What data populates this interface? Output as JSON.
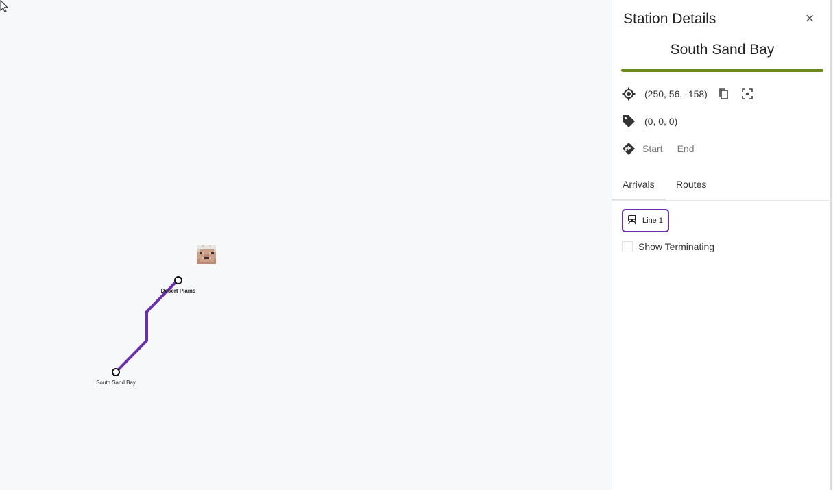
{
  "map": {
    "line_color": "#6a2fb0",
    "stations": [
      {
        "name": "Desert Plains",
        "bold": true
      },
      {
        "name": "South Sand Bay",
        "bold": false
      }
    ]
  },
  "panel": {
    "title": "Station Details",
    "close_icon": "close-icon",
    "station_name": "South Sand Bay",
    "line_color_bar": "#6b8a1c",
    "coordinates": "(250, 56, -158)",
    "tag_value": "(0, 0, 0)",
    "directions": {
      "start": "Start",
      "end": "End"
    },
    "tabs": [
      {
        "label": "Arrivals",
        "active": true
      },
      {
        "label": "Routes",
        "active": false
      }
    ],
    "line_chip": {
      "label": "Line 1",
      "icon": "train-icon",
      "color": "#6a2fb0"
    },
    "show_terminating": {
      "label": "Show Terminating",
      "checked": false
    }
  }
}
